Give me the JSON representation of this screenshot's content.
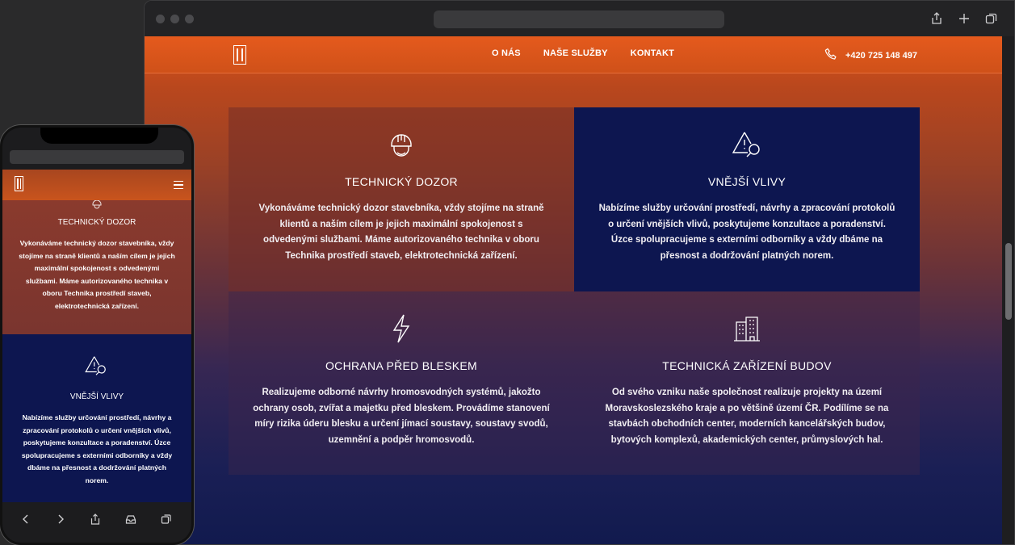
{
  "site": {
    "nav": [
      "O NÁS",
      "NAŠE SLUŽBY",
      "KONTAKT"
    ],
    "phone": "+420 725 148 497"
  },
  "cards": [
    {
      "icon": "hard-hat-icon",
      "title": "TECHNICKÝ DOZOR",
      "text": "Vykonáváme technický dozor stavebníka, vždy stojíme na straně klientů a naším cílem je jejich maximální spokojenost s odvedenými službami. Máme autorizovaného technika v oboru Technika prostředí staveb, elektrotechnická zařízení."
    },
    {
      "icon": "warning-search-icon",
      "title": "VNĚJŠÍ VLIVY",
      "text": "Nabízíme služby určování prostředí, návrhy a zpracování protokolů o určení vnějších vlivů, poskytujeme konzultace a poradenství. Úzce spolupracujeme s externími odborníky a vždy dbáme na přesnost a dodržování platných norem."
    },
    {
      "icon": "lightning-icon",
      "title": "OCHRANA PŘED BLESKEM",
      "text": "Realizujeme odborné návrhy hromosvodných systémů, jakožto ochrany osob, zvířat a majetku před bleskem. Provádíme stanovení míry rizika úderu blesku a určení jímací soustavy, soustavy svodů, uzemnění a podpěr hromosvodů."
    },
    {
      "icon": "building-icon",
      "title": "TECHNICKÁ ZAŘÍZENÍ BUDOV",
      "text": "Od svého vzniku naše společnost realizuje projekty na území Moravskoslezského kraje a po většině území ČR. Podílíme se na stavbách obchodních center, moderních kancelářských budov, bytových komplexů, akademických center, průmyslových hal."
    }
  ],
  "colors": {
    "accent_orange": "#e55a1d",
    "card_navy": "#0d1650",
    "card_brown": "#7a352f"
  }
}
